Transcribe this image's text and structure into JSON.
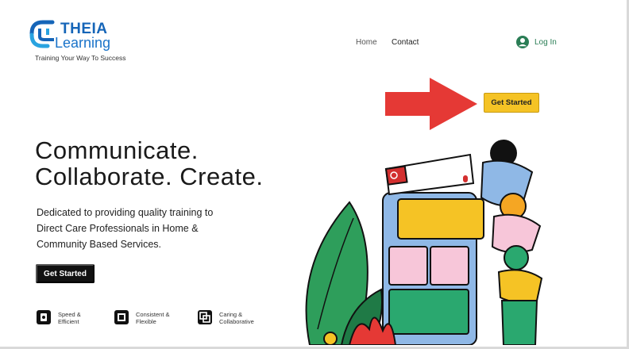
{
  "brand": {
    "name_line1": "THEIA",
    "name_line2": "Learning",
    "tagline": "Training Your Way To Success",
    "color": "#1565b8"
  },
  "nav": {
    "home": "Home",
    "contact": "Contact",
    "login": "Log In",
    "login_color": "#2a7d55"
  },
  "header_cta": {
    "label": "Get Started",
    "color": "#f5c325"
  },
  "annotation": {
    "icon": "red-arrow-icon",
    "color": "#e53935"
  },
  "hero": {
    "headline_line1": "Communicate.",
    "headline_line2": "Collaborate. Create.",
    "description": "Dedicated to providing quality training to Direct Care Professionals in Home & Community Based Services.",
    "cta_label": "Get Started"
  },
  "features": [
    {
      "icon": "badge-icon",
      "label": "Speed &\nEfficient"
    },
    {
      "icon": "square-frame-icon",
      "label": "Consistent &\nFlexible"
    },
    {
      "icon": "overlap-squares-icon",
      "label": "Caring &\nCollaborative"
    }
  ],
  "illustration": {
    "icon": "people-with-phone-illustration"
  }
}
